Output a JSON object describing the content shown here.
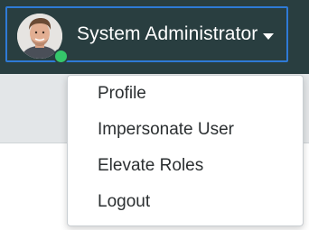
{
  "header": {
    "user_name": "System Administrator",
    "avatar_icon": "user-avatar",
    "presence_status": "online",
    "presence_color": "#35c76a",
    "caret_icon": "caret-down-icon"
  },
  "menu": {
    "items": [
      {
        "label": "Profile"
      },
      {
        "label": "Impersonate User"
      },
      {
        "label": "Elevate Roles"
      },
      {
        "label": "Logout"
      }
    ]
  },
  "colors": {
    "header_bg": "#293e40",
    "focus_outline": "#2e7ad6",
    "menu_text": "#2b2f31"
  }
}
